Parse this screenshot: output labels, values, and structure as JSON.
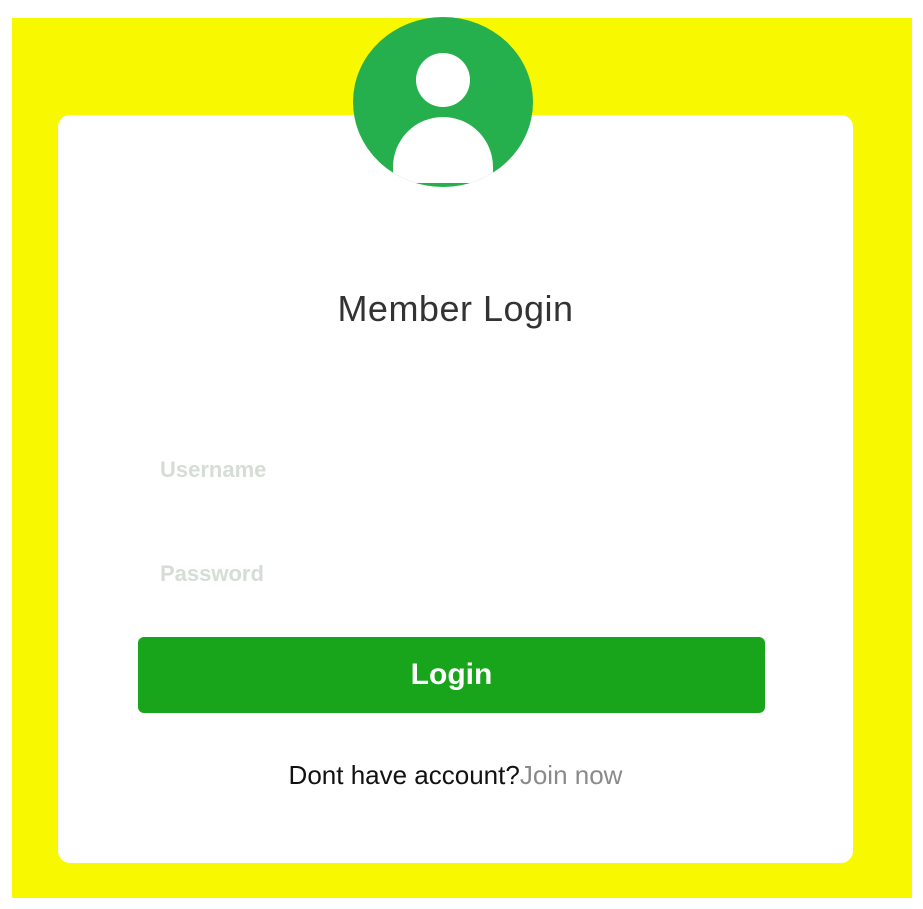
{
  "login": {
    "title": "Member Login",
    "username_placeholder": "Username",
    "password_placeholder": "Password",
    "button_label": "Login",
    "signup_prompt": "Dont have account?",
    "signup_link": "Join now"
  },
  "icons": {
    "avatar": "user-icon"
  },
  "colors": {
    "background": "#f8f800",
    "avatar": "#25b04d",
    "button": "#18a51c",
    "link": "#8a8a8a"
  }
}
